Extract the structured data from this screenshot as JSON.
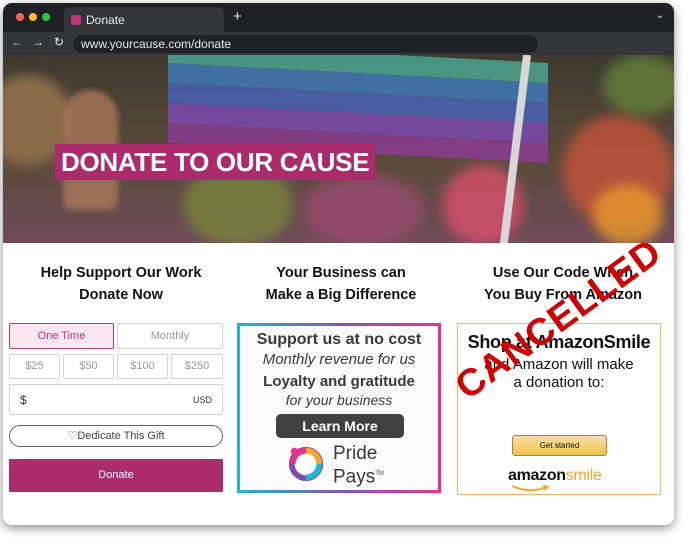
{
  "browser": {
    "tab_title": "Donate",
    "new_tab": "+",
    "tab_menu": "⌄",
    "back": "←",
    "forward": "→",
    "reload": "↻",
    "url": "www.yourcause.com/donate"
  },
  "hero": {
    "heading": "DONATE TO OUR CAUSE"
  },
  "columns": [
    {
      "line1": "Help Support Our Work",
      "line2": "Donate Now"
    },
    {
      "line1": "Your Business can",
      "line2": "Make a Big Difference"
    },
    {
      "line1": "Use Our Code When",
      "line2": "You Buy From Amazon"
    }
  ],
  "donate_form": {
    "frequency": [
      "One Time",
      "Monthly"
    ],
    "selected_frequency": "One Time",
    "amounts": [
      "$25",
      "$50",
      "$100",
      "$250"
    ],
    "currency_symbol": "$",
    "currency_code": "USD",
    "dedicate_label": "♡Dedicate This Gift",
    "donate_label": "Donate"
  },
  "pride_pays": {
    "line1": "Support us at no cost",
    "line2": "Monthly revenue for us",
    "line3": "Loyalty and gratitude",
    "line4": "for your business",
    "button": "Learn More",
    "logo_line1": "Pride",
    "logo_line2": "Pays",
    "trademark": "TM"
  },
  "amazon": {
    "title": "Shop at AmazonSmile",
    "line2": "and Amazon will make",
    "line3": "a donation to:",
    "button": "Get started",
    "logo_amazon": "amazon",
    "logo_smile": "smile",
    "stamp": "CANCELLED"
  },
  "colors": {
    "brand": "#ac2b6d",
    "stamp": "#d10000",
    "amazon_border": "#f5b563"
  }
}
